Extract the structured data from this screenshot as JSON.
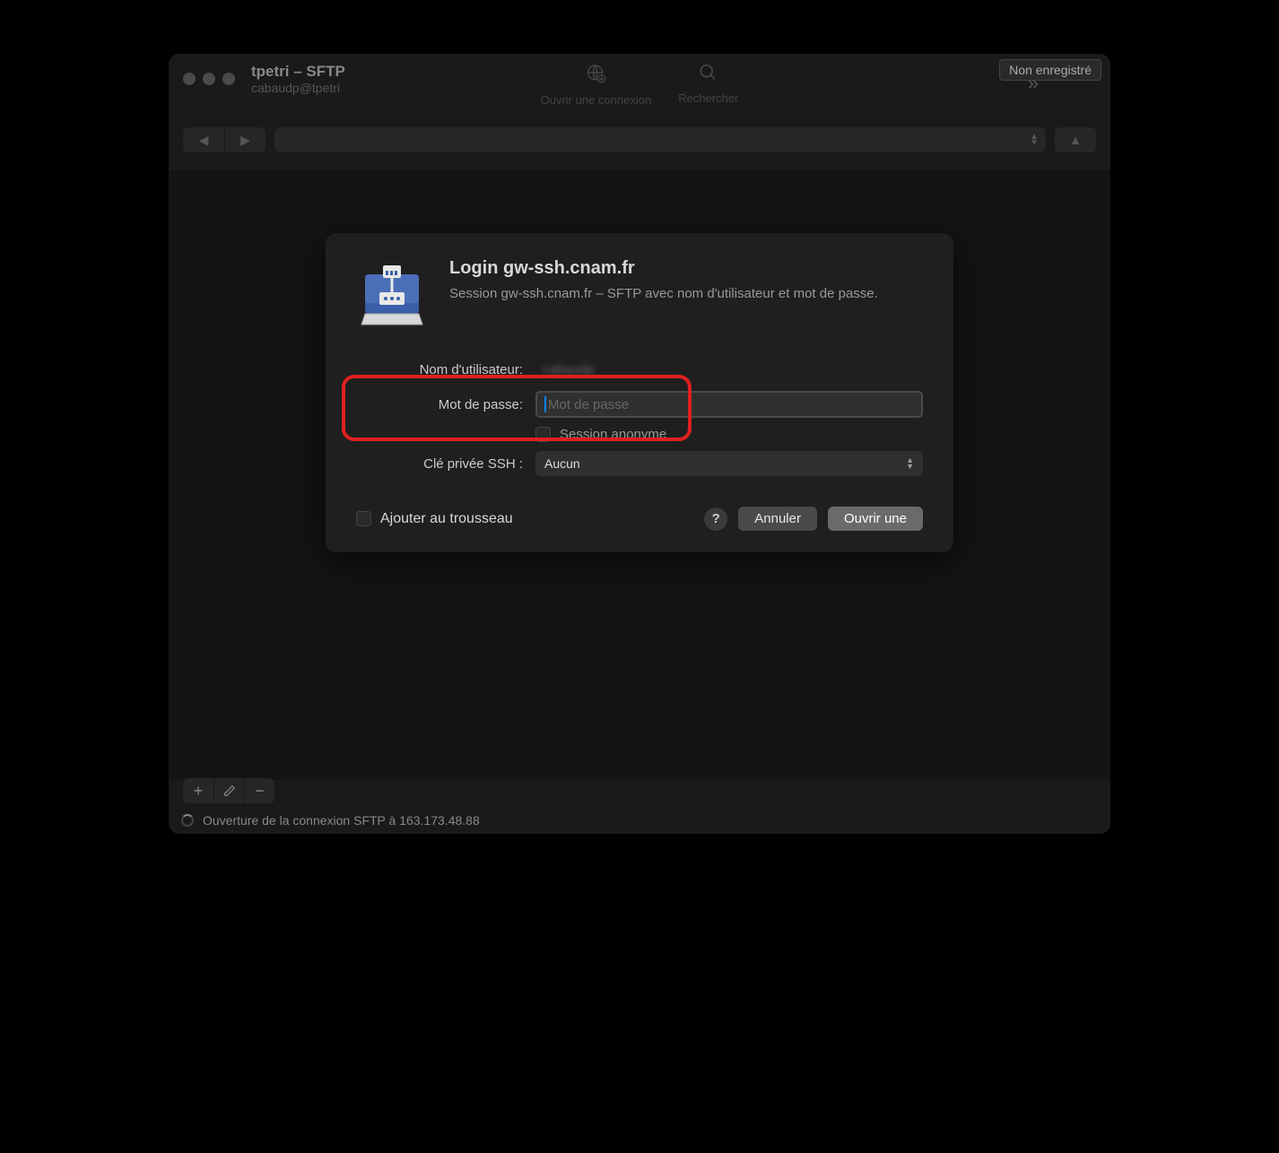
{
  "window": {
    "title": "tpetri – SFTP",
    "subtitle": "cabaudp@tpetri",
    "unregistered": "Non enregistré"
  },
  "toolbar": {
    "open_connection": "Ouvrir une connexion",
    "search": "Rechercher"
  },
  "dialog": {
    "title": "Login gw-ssh.cnam.fr",
    "description": "Session gw-ssh.cnam.fr – SFTP avec nom d'utilisateur et mot de passe.",
    "username_label": "Nom d'utilisateur:",
    "username_value": "cabaudp",
    "password_label": "Mot de passe:",
    "password_placeholder": "Mot de passe",
    "anonymous_label": "Session anonyme",
    "ssh_key_label": "Clé privée SSH :",
    "ssh_key_value": "Aucun",
    "keychain_label": "Ajouter au trousseau",
    "cancel": "Annuler",
    "open": "Ouvrir une"
  },
  "status": {
    "message": "Ouverture de la connexion SFTP à 163.173.48.88"
  }
}
